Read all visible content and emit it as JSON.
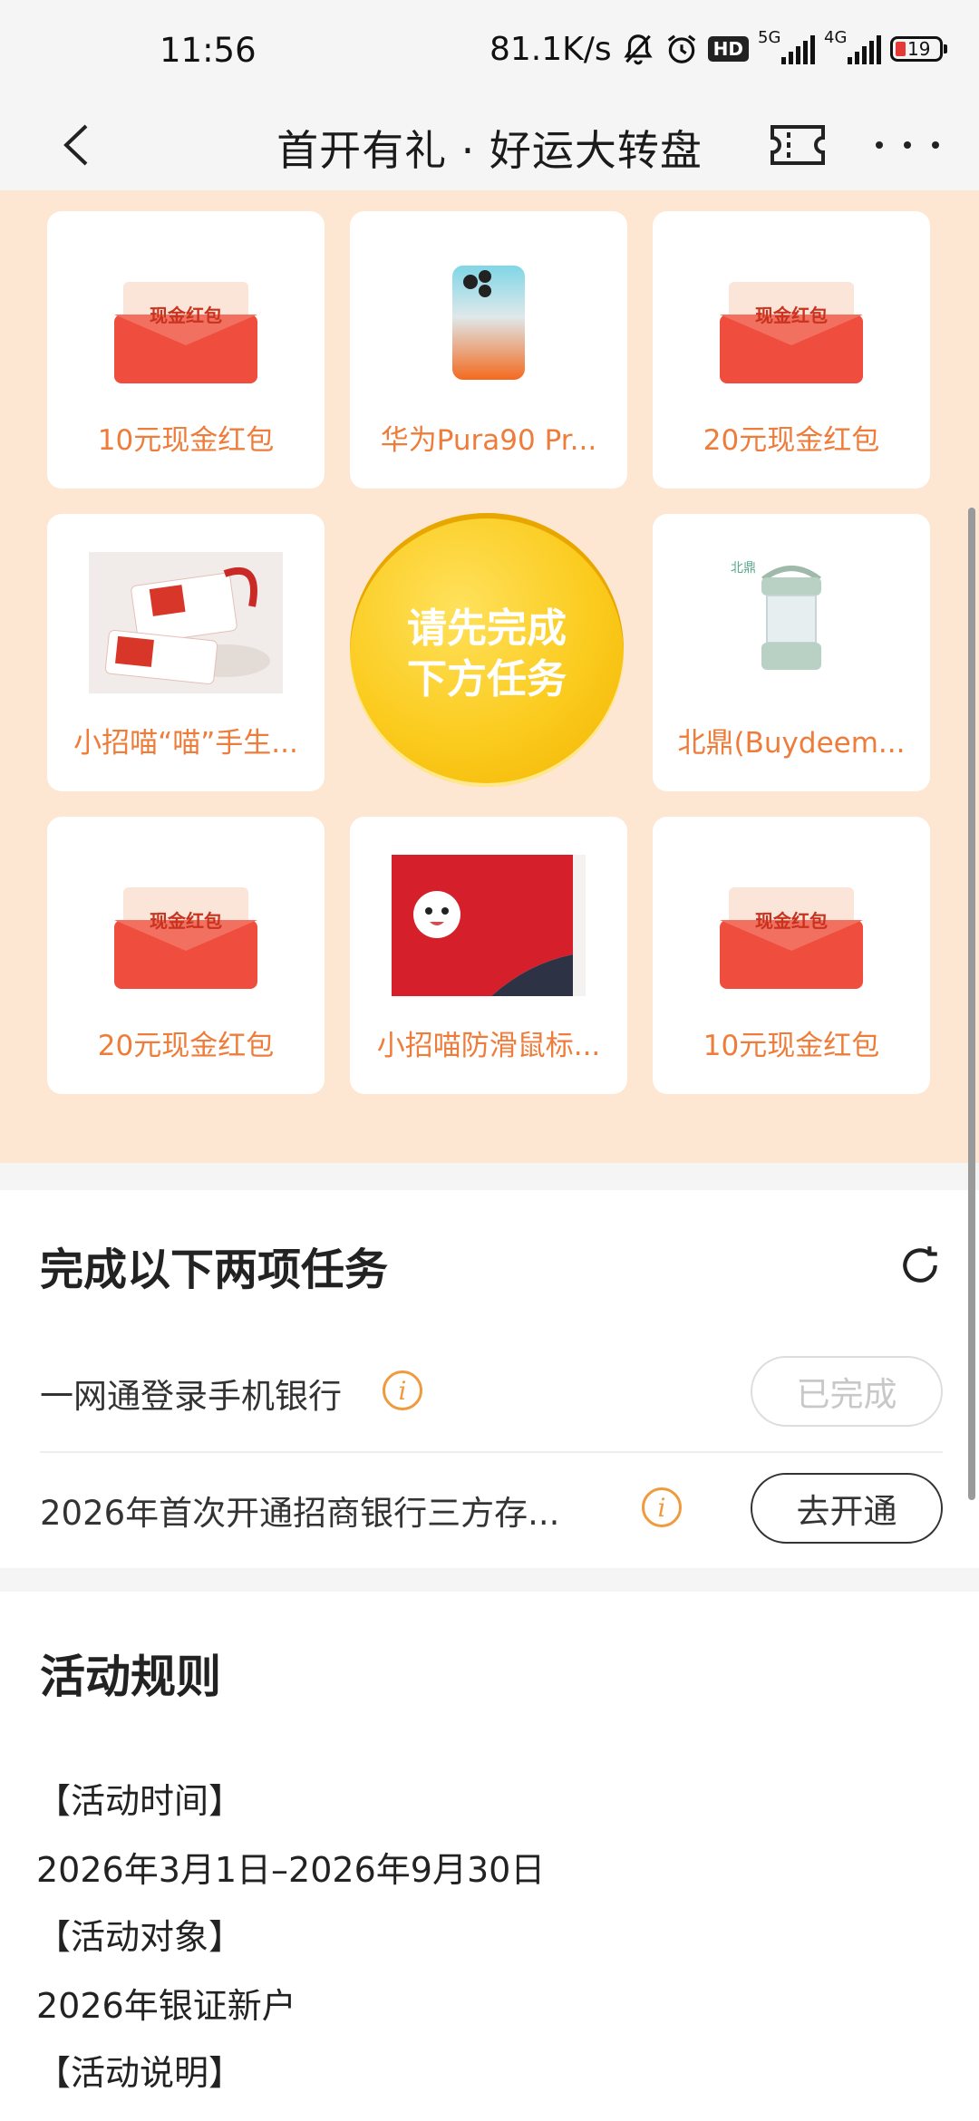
{
  "status_bar": {
    "time": "11:56",
    "net_speed": "81.1K/s",
    "hd_badge": "HD",
    "sig1_label": "5G",
    "sig2_label": "4G",
    "battery": "19"
  },
  "nav": {
    "title": "首开有礼 · 好运大转盘"
  },
  "prizes": {
    "redpack_text": "现金红包",
    "center_line1": "请先完成",
    "center_line2": "下方任务",
    "brand_mark": "北鼎",
    "items": [
      {
        "label": "10元现金红包"
      },
      {
        "label": "华为Pura90 Pr..."
      },
      {
        "label": "20元现金红包"
      },
      {
        "label": "小招喵“喵”手生..."
      },
      {
        "label": "北鼎(Buydeem..."
      },
      {
        "label": "20元现金红包"
      },
      {
        "label": "小招喵防滑鼠标..."
      },
      {
        "label": "10元现金红包"
      }
    ]
  },
  "tasks": {
    "title": "完成以下两项任务",
    "items": [
      {
        "label": "一网通登录手机银行",
        "info": "i",
        "button": "已完成",
        "state": "done"
      },
      {
        "label": "2026年首次开通招商银行三方存...",
        "info": "i",
        "button": "去开通",
        "state": "todo"
      }
    ]
  },
  "rules": {
    "title": "活动规则",
    "lines": [
      "【活动时间】",
      "2026年3月1日–2026年9月30日",
      "【活动对象】",
      "2026年银证新户",
      "【活动说明】"
    ]
  },
  "colors": {
    "prize_bg": "#fde7d3",
    "accent_orange": "#ee7c3a",
    "gold": "#fbcb1e"
  }
}
